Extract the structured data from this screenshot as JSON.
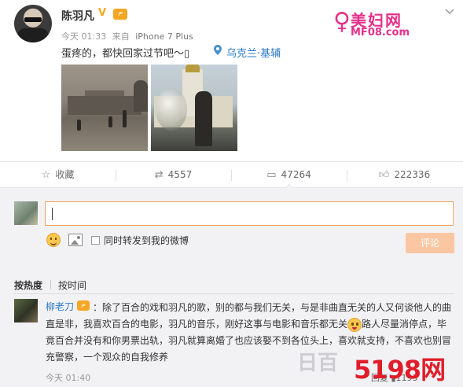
{
  "post": {
    "username": "陈羽凡",
    "vip_badge": "V",
    "level_badge": "ዎ",
    "time": "今天 01:33",
    "source_prefix": "来自",
    "device": "iPhone 7 Plus",
    "text": "蛋疼的，都快回家过节吧～▯",
    "location": "乌克兰·基辅",
    "location_icon": "location-pin-icon",
    "images": [
      "photo-square",
      "photo-church"
    ]
  },
  "watermark_top": {
    "figure": "♀",
    "cn": "美妇网",
    "url": "MF08.com"
  },
  "actions": {
    "favorite": {
      "icon": "star-icon",
      "label": "收藏"
    },
    "repost": {
      "icon": "repost-icon",
      "label": "4557"
    },
    "comment": {
      "icon": "comment-icon",
      "label": "47264"
    },
    "like": {
      "icon": "thumbs-up-icon",
      "label": "222336"
    }
  },
  "composer": {
    "input_value": "",
    "checkbox_label": "同时转发到我的微博",
    "submit_label": "评论"
  },
  "sort": {
    "hot": "按热度",
    "time": "按时间"
  },
  "comment": {
    "author": "柳老刀",
    "badge": "ዎ",
    "text_part1": "：除了百合的戏和羽凡的歌，别的都与我们无关，与是非曲直无关的人又何谈他人的曲直是非，我喜欢百合的电影，羽凡的音乐，刚好这事与电影和音乐都无关",
    "text_part2": "路人尽量消停点，毕竟百合并没有和你男票出轨，羽凡就算离婚了也应该娶不到各位头上，喜欢就支持，不喜欢也别冒充警察，一个观众的自我修养",
    "time": "今天 01:40",
    "actions": "回复  ▮1193"
  },
  "watermark_bottom": {
    "faint": "日百",
    "text": "5198网"
  },
  "colors": {
    "accent_link": "#2a7ac5",
    "input_border": "#f0a15c",
    "submit_bg": "#fbc7a2",
    "badge": "#f5a623",
    "watermark_pink": "#e6308a",
    "watermark_red": "#e11d2a"
  }
}
